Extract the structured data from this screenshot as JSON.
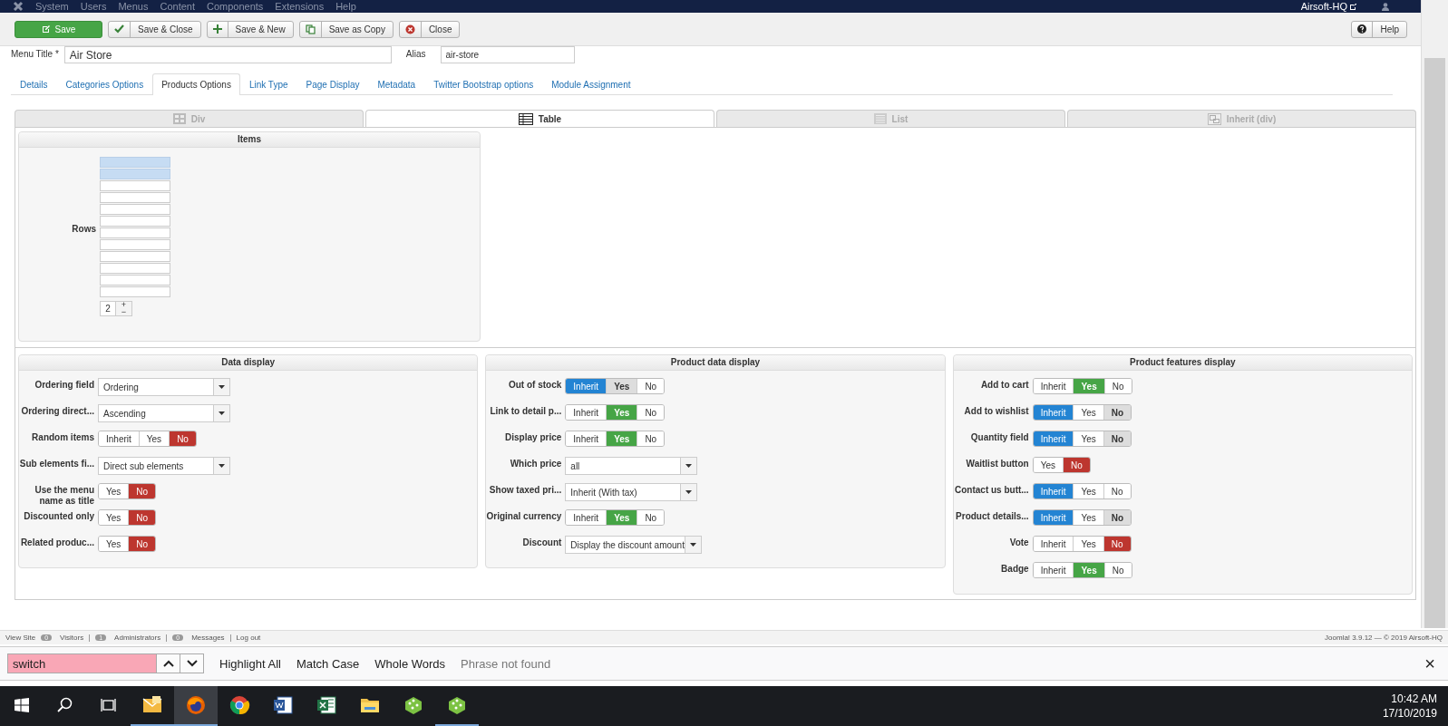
{
  "navbar": {
    "menus": [
      "System",
      "Users",
      "Menus",
      "Content",
      "Components",
      "Extensions",
      "Help"
    ],
    "site": "Airsoft-HQ"
  },
  "toolbar": {
    "buttons": [
      {
        "kind": "save",
        "label": "Save"
      },
      {
        "kind": "check",
        "label": "Save & Close"
      },
      {
        "kind": "plus",
        "label": "Save & New"
      },
      {
        "kind": "copy",
        "label": "Save as Copy"
      },
      {
        "kind": "close",
        "label": "Close"
      }
    ],
    "help": "Help"
  },
  "form": {
    "title_label": "Menu Title *",
    "title_value": "Air Store",
    "alias_label": "Alias",
    "alias_value": "air-store"
  },
  "tabs": [
    {
      "label": "Details",
      "selected": false
    },
    {
      "label": "Categories Options",
      "selected": false
    },
    {
      "label": "Products Options",
      "selected": true
    },
    {
      "label": "Link Type",
      "selected": false
    },
    {
      "label": "Page Display",
      "selected": false
    },
    {
      "label": "Metadata",
      "selected": false
    },
    {
      "label": "Twitter Bootstrap options",
      "selected": false
    },
    {
      "label": "Module Assignment",
      "selected": false
    }
  ],
  "layout_tabs": [
    {
      "kind": "div",
      "label": "Div",
      "selected": false
    },
    {
      "kind": "table",
      "label": "Table",
      "selected": true
    },
    {
      "kind": "list",
      "label": "List",
      "selected": false
    },
    {
      "kind": "inherit",
      "label": "Inherit (div)",
      "selected": false
    }
  ],
  "items": {
    "title": "Items",
    "rows_label": "Rows",
    "cells": [
      {
        "selected": true
      },
      {
        "selected": true
      },
      {
        "selected": false
      },
      {
        "selected": false
      },
      {
        "selected": false
      },
      {
        "selected": false
      },
      {
        "selected": false
      },
      {
        "selected": false
      },
      {
        "selected": false
      },
      {
        "selected": false
      },
      {
        "selected": false
      },
      {
        "selected": false
      }
    ],
    "spinner": {
      "value": "2",
      "up": "+",
      "down": "−"
    }
  },
  "panels": [
    {
      "title": "Data display",
      "fields": [
        {
          "kind": "select",
          "label": "Ordering field",
          "value": "Ordering"
        },
        {
          "kind": "select",
          "label": "Ordering direct...",
          "value": "Ascending"
        },
        {
          "kind": "toggle",
          "label": "Random items",
          "options": [
            {
              "kind": "inherit",
              "label": "Inherit",
              "selected": false,
              "shaded": false
            },
            {
              "kind": "yes",
              "label": "Yes",
              "selected": false,
              "shaded": false
            },
            {
              "kind": "no",
              "label": "No",
              "selected": true,
              "shaded": false
            }
          ]
        },
        {
          "kind": "select",
          "label": "Sub elements fi...",
          "value": "Direct sub elements"
        },
        {
          "kind": "toggle",
          "label": "Use the menu name as title",
          "options": [
            {
              "kind": "yes",
              "label": "Yes",
              "selected": false,
              "shaded": false
            },
            {
              "kind": "no",
              "label": "No",
              "selected": true,
              "shaded": false
            }
          ]
        },
        {
          "kind": "toggle",
          "label": "Discounted only",
          "options": [
            {
              "kind": "yes",
              "label": "Yes",
              "selected": false,
              "shaded": false
            },
            {
              "kind": "no",
              "label": "No",
              "selected": true,
              "shaded": false
            }
          ]
        },
        {
          "kind": "toggle",
          "label": "Related produc...",
          "options": [
            {
              "kind": "yes",
              "label": "Yes",
              "selected": false,
              "shaded": false
            },
            {
              "kind": "no",
              "label": "No",
              "selected": true,
              "shaded": false
            }
          ]
        }
      ]
    },
    {
      "title": "Product data display",
      "fields": [
        {
          "kind": "toggle",
          "label": "Out of stock",
          "options": [
            {
              "kind": "inherit",
              "label": "Inherit",
              "selected": true,
              "shaded": false
            },
            {
              "kind": "yes",
              "label": "Yes",
              "selected": false,
              "shaded": true
            },
            {
              "kind": "no",
              "label": "No",
              "selected": false,
              "shaded": false
            }
          ]
        },
        {
          "kind": "toggle",
          "label": "Link to detail p...",
          "options": [
            {
              "kind": "inherit",
              "label": "Inherit",
              "selected": false,
              "shaded": false
            },
            {
              "kind": "yes",
              "label": "Yes",
              "selected": true,
              "shaded": false
            },
            {
              "kind": "no",
              "label": "No",
              "selected": false,
              "shaded": false
            }
          ]
        },
        {
          "kind": "toggle",
          "label": "Display price",
          "options": [
            {
              "kind": "inherit",
              "label": "Inherit",
              "selected": false,
              "shaded": false
            },
            {
              "kind": "yes",
              "label": "Yes",
              "selected": true,
              "shaded": false
            },
            {
              "kind": "no",
              "label": "No",
              "selected": false,
              "shaded": false
            }
          ]
        },
        {
          "kind": "select",
          "label": "Which price",
          "value": "all"
        },
        {
          "kind": "select",
          "label": "Show taxed pri...",
          "value": "Inherit (With tax)"
        },
        {
          "kind": "toggle",
          "label": "Original currency",
          "options": [
            {
              "kind": "inherit",
              "label": "Inherit",
              "selected": false,
              "shaded": false
            },
            {
              "kind": "yes",
              "label": "Yes",
              "selected": true,
              "shaded": false
            },
            {
              "kind": "no",
              "label": "No",
              "selected": false,
              "shaded": false
            }
          ]
        },
        {
          "kind": "select",
          "label": "Discount",
          "value": "Display the discount amount"
        }
      ]
    },
    {
      "title": "Product features display",
      "fields": [
        {
          "kind": "toggle",
          "label": "Add to cart",
          "options": [
            {
              "kind": "inherit",
              "label": "Inherit",
              "selected": false,
              "shaded": false
            },
            {
              "kind": "yes",
              "label": "Yes",
              "selected": true,
              "shaded": false
            },
            {
              "kind": "no",
              "label": "No",
              "selected": false,
              "shaded": false
            }
          ]
        },
        {
          "kind": "toggle",
          "label": "Add to wishlist",
          "options": [
            {
              "kind": "inherit",
              "label": "Inherit",
              "selected": true,
              "shaded": false
            },
            {
              "kind": "yes",
              "label": "Yes",
              "selected": false,
              "shaded": false
            },
            {
              "kind": "no",
              "label": "No",
              "selected": false,
              "shaded": true
            }
          ]
        },
        {
          "kind": "toggle",
          "label": "Quantity field",
          "options": [
            {
              "kind": "inherit",
              "label": "Inherit",
              "selected": true,
              "shaded": false
            },
            {
              "kind": "yes",
              "label": "Yes",
              "selected": false,
              "shaded": false
            },
            {
              "kind": "no",
              "label": "No",
              "selected": false,
              "shaded": true
            }
          ]
        },
        {
          "kind": "toggle",
          "label": "Waitlist button",
          "options": [
            {
              "kind": "yes",
              "label": "Yes",
              "selected": false,
              "shaded": false
            },
            {
              "kind": "no",
              "label": "No",
              "selected": true,
              "shaded": false
            }
          ]
        },
        {
          "kind": "toggle",
          "label": "Contact us butt...",
          "options": [
            {
              "kind": "inherit",
              "label": "Inherit",
              "selected": true,
              "shaded": false
            },
            {
              "kind": "yes",
              "label": "Yes",
              "selected": false,
              "shaded": false
            },
            {
              "kind": "no",
              "label": "No",
              "selected": false,
              "shaded": false
            }
          ]
        },
        {
          "kind": "toggle",
          "label": "Product details...",
          "options": [
            {
              "kind": "inherit",
              "label": "Inherit",
              "selected": true,
              "shaded": false
            },
            {
              "kind": "yes",
              "label": "Yes",
              "selected": false,
              "shaded": false
            },
            {
              "kind": "no",
              "label": "No",
              "selected": false,
              "shaded": true
            }
          ]
        },
        {
          "kind": "toggle",
          "label": "Vote",
          "options": [
            {
              "kind": "inherit",
              "label": "Inherit",
              "selected": false,
              "shaded": false
            },
            {
              "kind": "yes",
              "label": "Yes",
              "selected": false,
              "shaded": false
            },
            {
              "kind": "no",
              "label": "No",
              "selected": true,
              "shaded": false
            }
          ]
        },
        {
          "kind": "toggle",
          "label": "Badge",
          "options": [
            {
              "kind": "inherit",
              "label": "Inherit",
              "selected": false,
              "shaded": false
            },
            {
              "kind": "yes",
              "label": "Yes",
              "selected": true,
              "shaded": false
            },
            {
              "kind": "no",
              "label": "No",
              "selected": false,
              "shaded": false
            }
          ]
        }
      ]
    }
  ],
  "status_bar": {
    "view_site": "View Site",
    "counters": [
      {
        "count": "0",
        "label": "Visitors"
      },
      {
        "count": "1",
        "label": "Administrators"
      },
      {
        "count": "0",
        "label": "Messages"
      }
    ],
    "logout": "Log out",
    "version": "Joomla! 3.9.12 — © 2019 Airsoft-HQ"
  },
  "find_bar": {
    "value": "switch",
    "not_found": true,
    "options": [
      "Highlight All",
      "Match Case",
      "Whole Words"
    ],
    "status": "Phrase not found",
    "close": "×"
  },
  "taskbar": {
    "apps": [
      {
        "kind": "mail",
        "running": true,
        "active": false
      },
      {
        "kind": "firefox",
        "running": true,
        "active": true
      },
      {
        "kind": "chrome",
        "running": false,
        "active": false
      },
      {
        "kind": "word",
        "running": false,
        "active": false
      },
      {
        "kind": "excel",
        "running": false,
        "active": false
      },
      {
        "kind": "folder",
        "running": false,
        "active": false
      },
      {
        "kind": "dice",
        "running": false,
        "active": false
      },
      {
        "kind": "dice",
        "running": true,
        "active": false
      }
    ],
    "time": "10:42 AM",
    "date": "17/10/2019"
  }
}
